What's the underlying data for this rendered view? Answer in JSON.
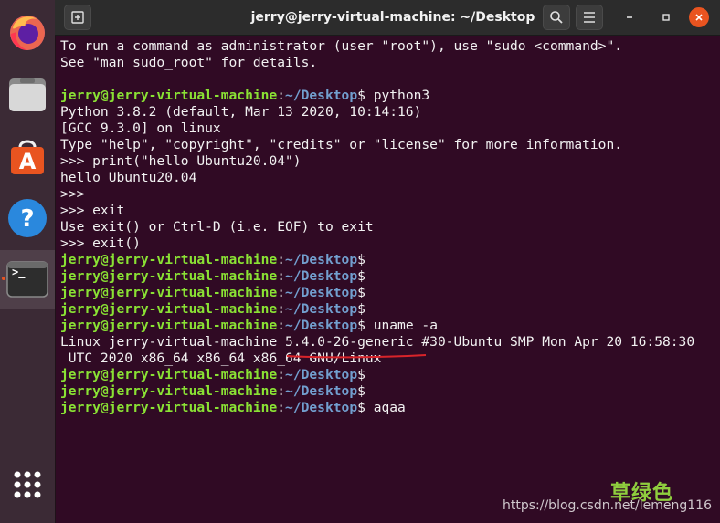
{
  "window": {
    "title": "jerry@jerry-virtual-machine: ~/Desktop"
  },
  "dock": {
    "items": [
      {
        "name": "firefox-icon"
      },
      {
        "name": "files-icon"
      },
      {
        "name": "software-icon"
      },
      {
        "name": "help-icon"
      },
      {
        "name": "terminal-icon",
        "active": true,
        "glyph": ">_"
      }
    ]
  },
  "prompt": {
    "user": "jerry@jerry-virtual-machine",
    "sep": ":",
    "path": "~/Desktop",
    "sign": "$"
  },
  "terminal": {
    "lines": [
      {
        "type": "text",
        "text": "To run a command as administrator (user \"root\"), use \"sudo <command>\"."
      },
      {
        "type": "text",
        "text": "See \"man sudo_root\" for details."
      },
      {
        "type": "text",
        "text": ""
      },
      {
        "type": "prompt",
        "cmd": " python3"
      },
      {
        "type": "text",
        "text": "Python 3.8.2 (default, Mar 13 2020, 10:14:16)"
      },
      {
        "type": "text",
        "text": "[GCC 9.3.0] on linux"
      },
      {
        "type": "text",
        "text": "Type \"help\", \"copyright\", \"credits\" or \"license\" for more information."
      },
      {
        "type": "text",
        "text": ">>> print(\"hello Ubuntu20.04\")"
      },
      {
        "type": "text",
        "text": "hello Ubuntu20.04"
      },
      {
        "type": "text",
        "text": ">>>"
      },
      {
        "type": "text",
        "text": ">>> exit"
      },
      {
        "type": "text",
        "text": "Use exit() or Ctrl-D (i.e. EOF) to exit"
      },
      {
        "type": "text",
        "text": ">>> exit()"
      },
      {
        "type": "prompt",
        "cmd": ""
      },
      {
        "type": "prompt",
        "cmd": ""
      },
      {
        "type": "prompt",
        "cmd": ""
      },
      {
        "type": "prompt",
        "cmd": ""
      },
      {
        "type": "prompt",
        "cmd": " uname -a"
      },
      {
        "type": "kernel",
        "pre": "Linux jerry-virtual-machine ",
        "kver": "5.4.0-26-generic",
        "post": " #30-Ubuntu SMP Mon Apr 20 16:58:30"
      },
      {
        "type": "text",
        "text": " UTC 2020 x86_64 x86_64 x86_64 GNU/Linux"
      },
      {
        "type": "prompt",
        "cmd": ""
      },
      {
        "type": "prompt",
        "cmd": ""
      },
      {
        "type": "prompt",
        "cmd": " aqaa"
      }
    ]
  },
  "watermark": {
    "logo": "草绿色",
    "url": "https://blog.csdn.net/lemeng116"
  },
  "colors": {
    "background": "#300a24",
    "user": "#8ae234",
    "path": "#729fcf",
    "close": "#e95420"
  }
}
